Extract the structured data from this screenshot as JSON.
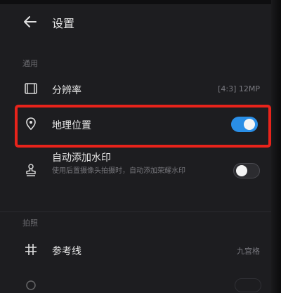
{
  "header": {
    "title": "设置"
  },
  "sections": {
    "general": "通用",
    "shooting": "拍照"
  },
  "rows": {
    "resolution": {
      "label": "分辨率",
      "value": "[4:3] 12MP"
    },
    "location": {
      "label": "地理位置",
      "toggle": "on"
    },
    "watermark": {
      "label": "自动添加水印",
      "subtitle": "使用后置摄像头拍摄时，自动添加荣耀水印",
      "toggle": "off"
    },
    "grid": {
      "label": "参考线",
      "value": "九宫格"
    }
  },
  "colors": {
    "accent": "#2a8ee6",
    "highlight": "#e8231b"
  }
}
